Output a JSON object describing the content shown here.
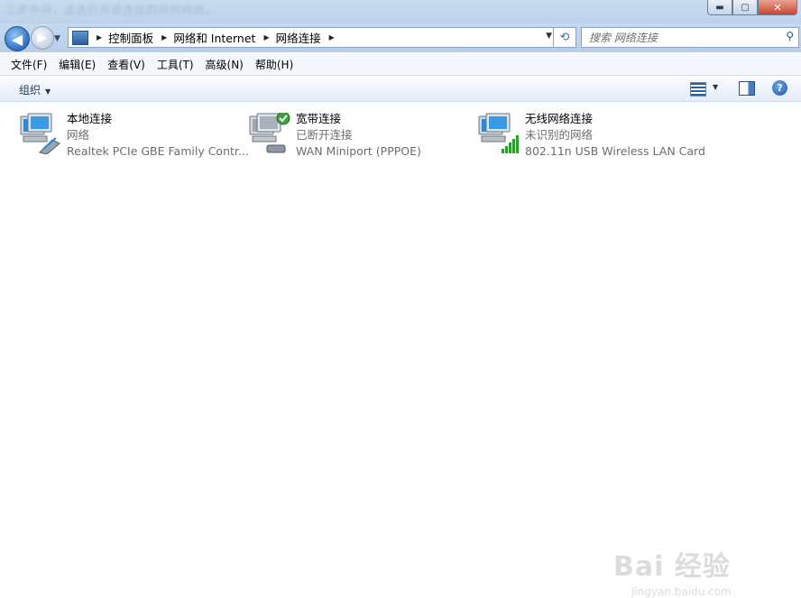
{
  "titlebar": {
    "blurred_text": "三步中间，这选已开设连接的间的网络。",
    "min_glyph": "▬",
    "max_glyph": "▢",
    "close_glyph": "✕"
  },
  "navbar": {
    "back_glyph": "◀",
    "forward_glyph": "▶",
    "history_glyph": "▼",
    "breadcrumb": [
      "控制面板",
      "网络和 Internet",
      "网络连接"
    ],
    "separator_glyph": "▶",
    "dropdown_glyph": "▼",
    "refresh_glyph": "⟲",
    "search_placeholder": "搜索 网络连接",
    "search_glyph": "⚲"
  },
  "menu": [
    "文件(F)",
    "编辑(E)",
    "查看(V)",
    "工具(T)",
    "高级(N)",
    "帮助(H)"
  ],
  "commandbar": {
    "organize_label": "组织",
    "organize_arrow": "▼",
    "view_arrow": "▼",
    "help_label": "?"
  },
  "connections": [
    {
      "name": "本地连接",
      "status": "网络",
      "device": "Realtek PCIe GBE Family Contr...",
      "icon": "network-computer-cable-icon"
    },
    {
      "name": "宽带连接",
      "status": "已断开连接",
      "device": "WAN Miniport (PPPOE)",
      "icon": "network-computer-modem-icon"
    },
    {
      "name": "无线网络连接",
      "status": "未识别的网络",
      "device": "802.11n USB Wireless LAN Card",
      "icon": "network-computer-wireless-icon"
    }
  ],
  "watermark": {
    "brand": "Bai 经验",
    "url": "jingyan.baidu.com"
  },
  "colors": {
    "accent": "#2b6fc7",
    "status_ok": "#3aa33a",
    "signal": "#2e9b2e"
  }
}
